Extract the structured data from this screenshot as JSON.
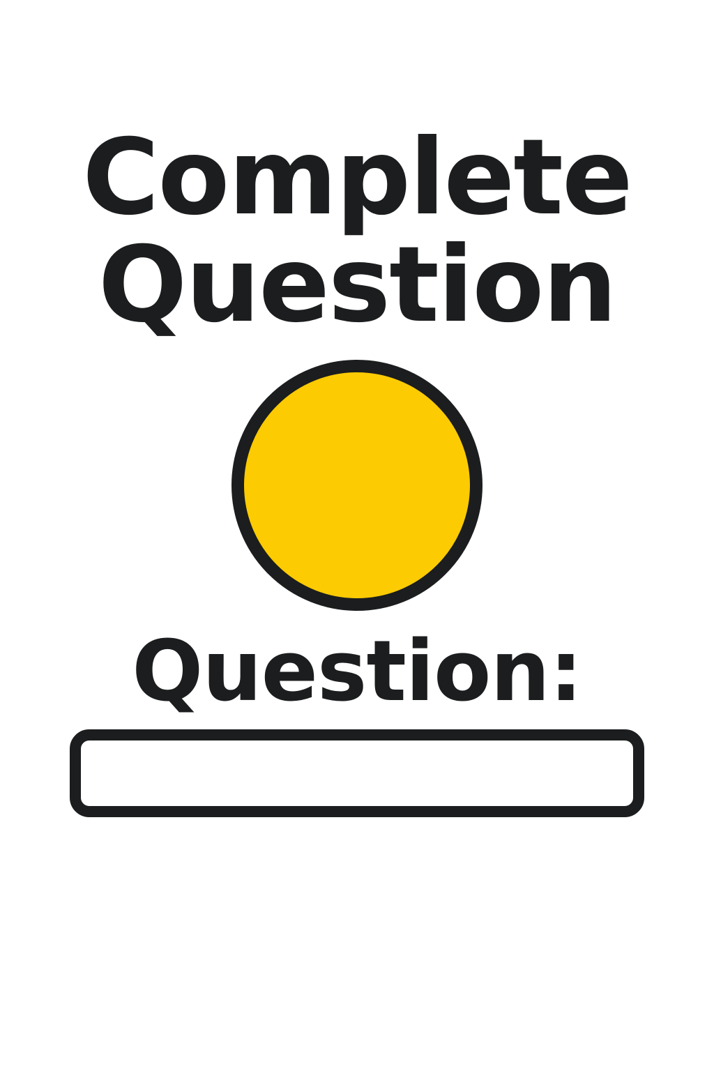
{
  "header": {
    "title_line1": "Complete",
    "title_line2": "Question"
  },
  "indicator": {
    "fill_color": "#FDCB02",
    "border_color": "#1B1D1E",
    "shape": "circle"
  },
  "question": {
    "label": "Question:",
    "value": "",
    "placeholder": ""
  },
  "colors": {
    "text": "#1B1D1E",
    "background": "#FFFFFF",
    "accent": "#FDCB02"
  }
}
